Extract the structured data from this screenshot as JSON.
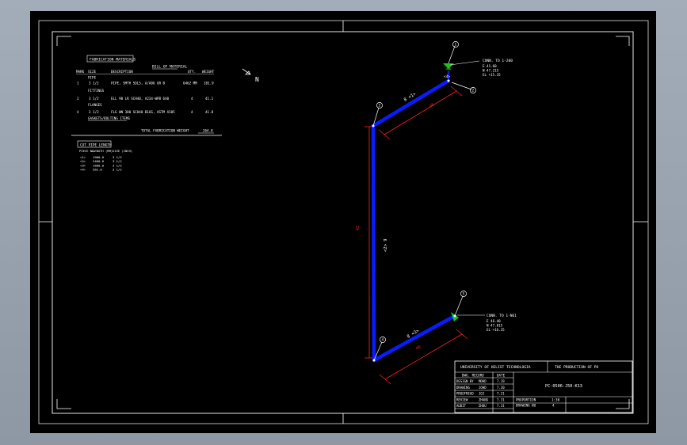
{
  "colors": {
    "background": "#000000",
    "pipe": "#0a1cff",
    "dimension": "#ff2020",
    "line": "#ffffff",
    "valve": "#19c419",
    "outer": "#96a0ad"
  },
  "bom": {
    "title": "FABRICATION MATERIALS",
    "subtitle": "BILL OF MATERIAL",
    "headers": {
      "mark": "MARK",
      "size": "SIZE",
      "description": "DESCRIPTION",
      "qty": "QTY.",
      "weight": "WEIGHT"
    },
    "sections": [
      {
        "label": "PIPE",
        "rows": [
          {
            "mark": "1",
            "size": "3 1/2",
            "description": "PIPE, SMTH SDL5, A/A06 GR B",
            "qty": "6462 MM",
            "weight": "181.9"
          }
        ]
      },
      {
        "label": "FITTINGS",
        "rows": [
          {
            "mark": "2",
            "size": "3 1/2",
            "description": "ELL 90 LR SCH40, A234-WPB 6X0",
            "qty": "4",
            "weight": "41.1"
          }
        ]
      },
      {
        "label": "FLANGES",
        "rows": [
          {
            "mark": "4",
            "size": "3 1/2",
            "description": "FLG WN 300 SCH40 B16S, ASTM A105",
            "qty": "4",
            "weight": "41.8"
          }
        ]
      }
    ],
    "gaskets_label": "GASKETS/BOLTING ITEMS",
    "total_label": "TOTAL FABRICATION WEIGHT",
    "total_value": "264.8"
  },
  "cut_table": {
    "title": "CUT PIPE LENGTH",
    "headers": [
      "PIECE NO.",
      "LENGTH (MM)",
      "SIZE (INCH)"
    ],
    "rows": [
      [
        "<1>",
        "1900.0",
        "3 1/2"
      ],
      [
        "<2>",
        "2400.0",
        "3 1/2"
      ],
      [
        "<3>",
        "1600.0",
        "3 1/2"
      ],
      [
        "<4>",
        "562.0",
        "3 1/2"
      ]
    ]
  },
  "north_label": "N",
  "callouts": {
    "top": {
      "title": "CONN. TO 1-200",
      "lines": [
        "E 41.60",
        "N 47.215",
        "EL +15.35"
      ]
    },
    "bottom": {
      "title": "CONN. TO 1-N61",
      "lines": [
        "E 46.40",
        "N 47.815",
        "EL +16.35"
      ]
    }
  },
  "markers": [
    "1",
    "2",
    "3",
    "4",
    "5"
  ],
  "pipe_labels": {
    "top_segment": "8 <1>",
    "vertical": "<2> 9",
    "bottom_segment": "8 <3>",
    "upper_end": "<4>"
  },
  "dimensions": {
    "top": "48",
    "vertical": "42",
    "bottom": "48"
  },
  "title_block": {
    "university": "UNIVERSITY OF HELIST TECHNOLOGIA",
    "project": "THE PRODUCTION OF PO",
    "drawing_number": "PC-0506-J50-K13",
    "record_header": "DWG. RECORD",
    "date_header": "DATE",
    "rows": [
      {
        "label": "DESIGN BY",
        "name": "MOHD",
        "date": "7.19"
      },
      {
        "label": "DRAWING",
        "name": "JOHD",
        "date": "7.20"
      },
      {
        "label": "PROOFREAD",
        "name": "JOJ",
        "date": "7.21"
      },
      {
        "label": "REVIEW",
        "name": "ZHANG",
        "date": "7.31"
      },
      {
        "label": "AUDIT",
        "name": "ZHOU",
        "date": "7.31"
      }
    ],
    "proportion_label": "PROPORTION",
    "proportion_value": "1:30",
    "drawing_no_label": "DRAWING NO",
    "drawing_no_value": "4"
  }
}
